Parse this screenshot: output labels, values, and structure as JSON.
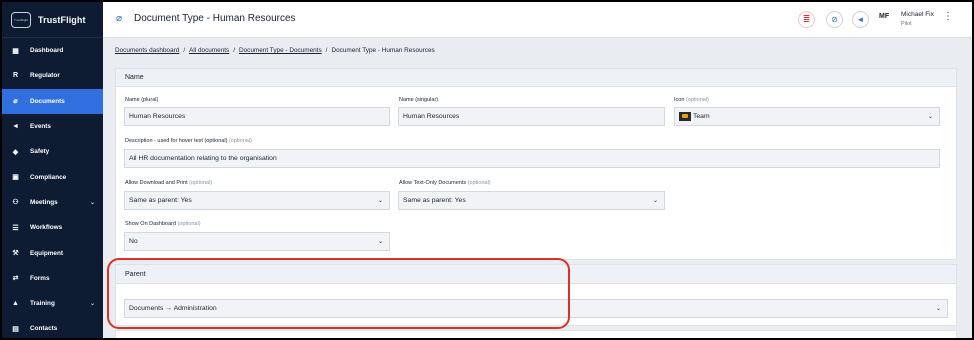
{
  "brand": {
    "name": "TrustFlight",
    "logo_text": "TrustFlight"
  },
  "sidebar": {
    "items": [
      {
        "label": "Dashboard",
        "icon": "dashboard-icon",
        "glyph": "▦"
      },
      {
        "label": "Regulator",
        "icon": "regulator-icon",
        "glyph": "R"
      },
      {
        "label": "Documents",
        "icon": "paperclip-icon",
        "glyph": "⌀",
        "active": true
      },
      {
        "label": "Events",
        "icon": "megaphone-icon",
        "glyph": "◄"
      },
      {
        "label": "Safety",
        "icon": "shield-icon",
        "glyph": "◆"
      },
      {
        "label": "Compliance",
        "icon": "clipboard-icon",
        "glyph": "▣"
      },
      {
        "label": "Meetings",
        "icon": "meetings-icon",
        "glyph": "⚇",
        "has_chevron": true
      },
      {
        "label": "Workflows",
        "icon": "stack-icon",
        "glyph": "☰"
      },
      {
        "label": "Equipment",
        "icon": "wrench-icon",
        "glyph": "⚒"
      },
      {
        "label": "Forms",
        "icon": "forms-icon",
        "glyph": "⇄"
      },
      {
        "label": "Training",
        "icon": "graduation-cap-icon",
        "glyph": "▲",
        "has_chevron": true
      },
      {
        "label": "Contacts",
        "icon": "contacts-icon",
        "glyph": "▤"
      }
    ]
  },
  "header": {
    "title": "Document Type - Human Resources",
    "user": {
      "initials": "MF",
      "name": "Michael Fix",
      "role": "Pilot"
    }
  },
  "breadcrumb": {
    "items": [
      "Documents dashboard",
      "All documents",
      "Document Type - Documents"
    ],
    "current": "Document Type - Human Resources",
    "separator": "/"
  },
  "name_panel": {
    "title": "Name",
    "plural_label": "Name (plural)",
    "plural_value": "Human Resources",
    "singular_label": "Name (singular)",
    "singular_value": "Human Resources",
    "icon_label": "Icon",
    "icon_value": "Team",
    "optional": "(optional)",
    "description_label": "Description - used for hover text (optional)",
    "description_value": "All HR documentation relating to the organisation",
    "download_label": "Allow Download and Print",
    "download_value": "Same as parent: Yes",
    "textonly_label": "Allow Text-Only Documents",
    "textonly_value": "Same as parent: Yes",
    "dashboard_label": "Show On Dashboard",
    "dashboard_value": "No"
  },
  "parent_panel": {
    "title": "Parent",
    "value": "Documents → Administration"
  },
  "colors": {
    "sidebar_bg": "#0d1b33",
    "active": "#2f6fe0",
    "highlight": "#d9302a"
  }
}
